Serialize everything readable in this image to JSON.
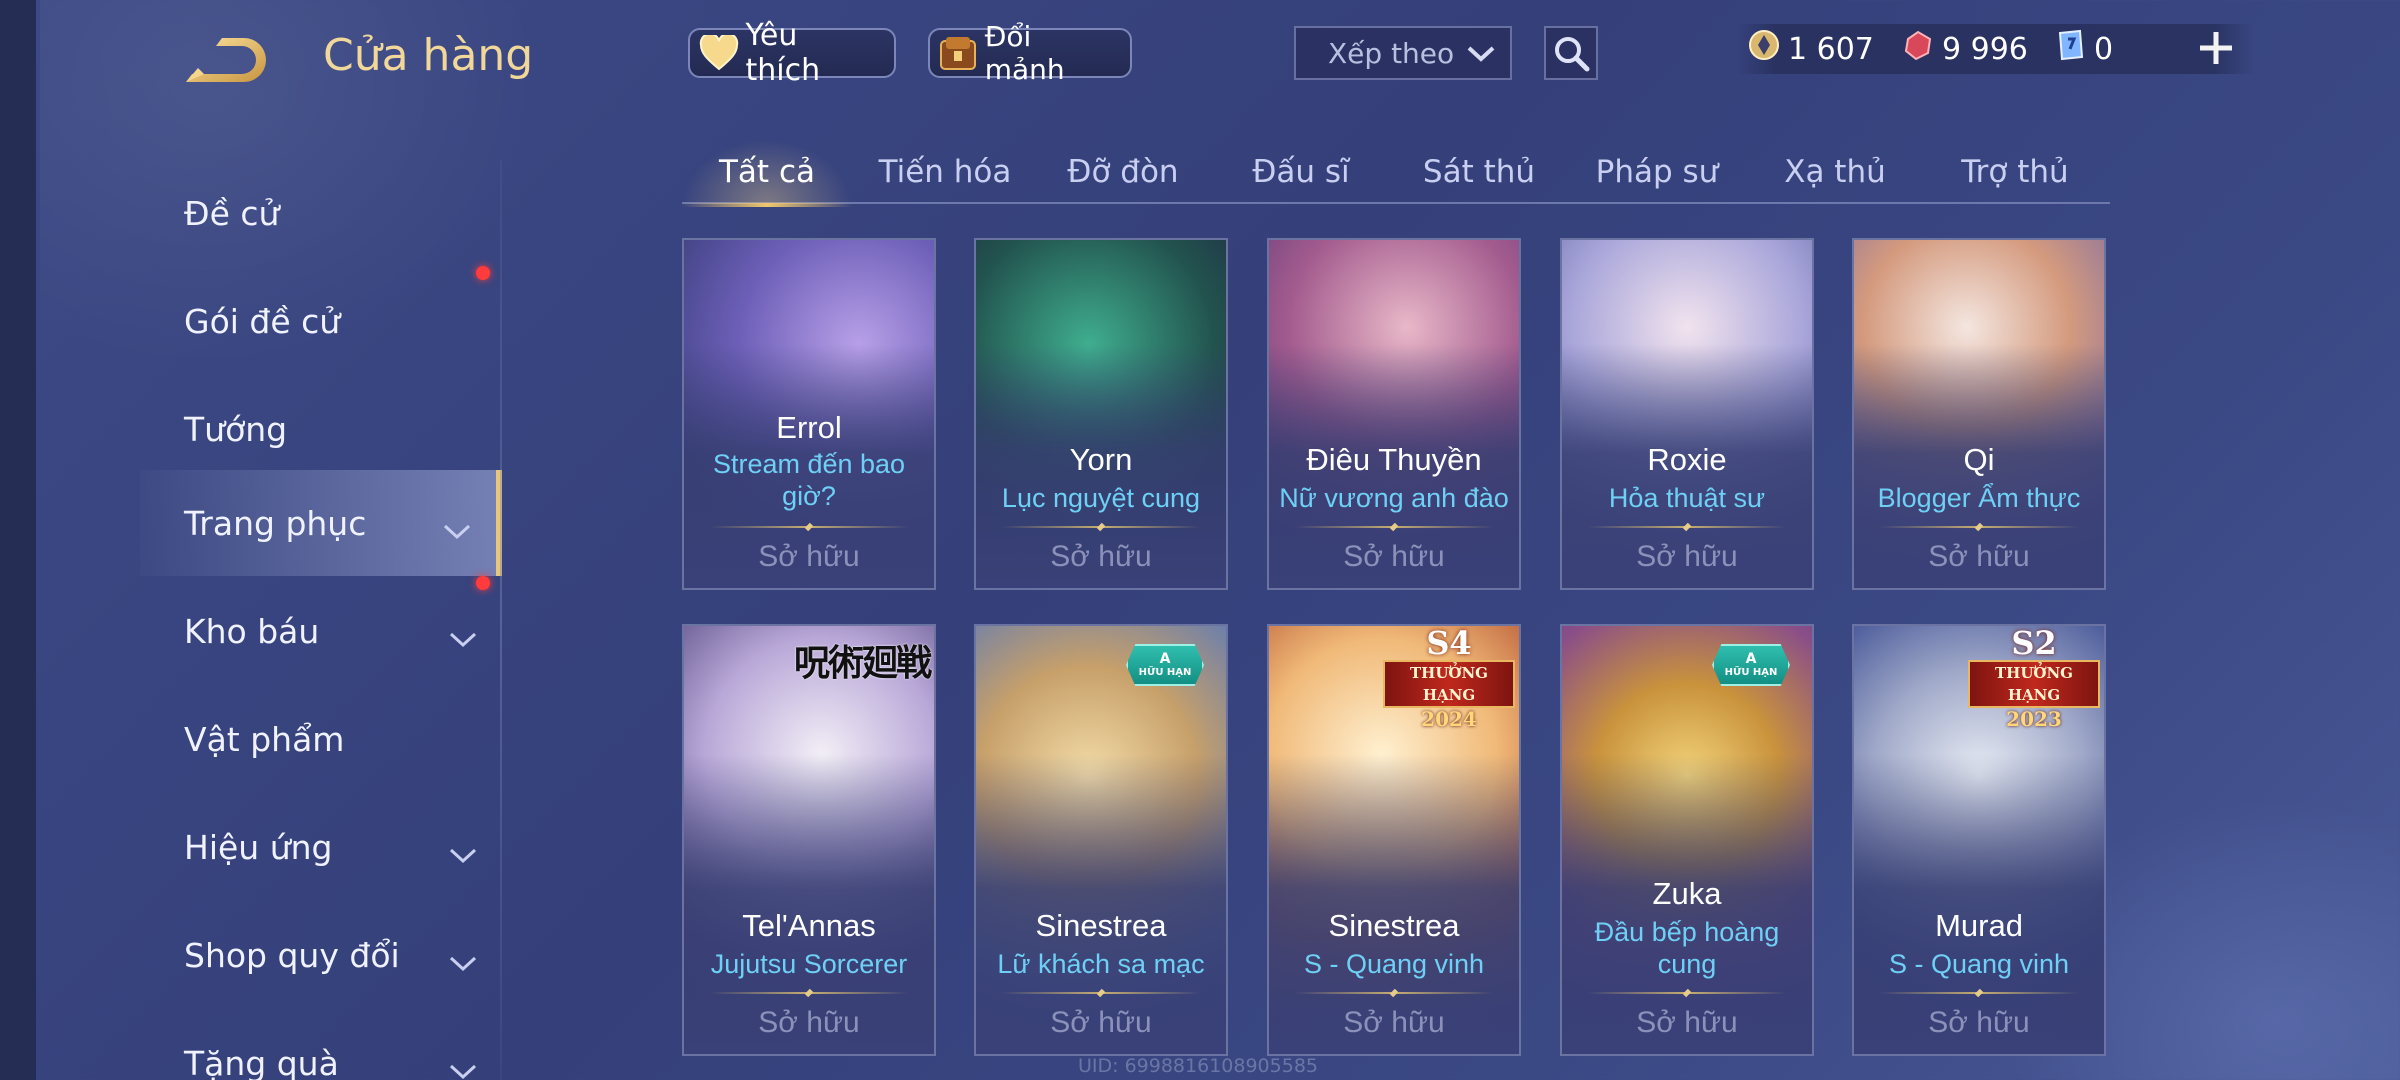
{
  "header": {
    "title": "Cửa hàng",
    "favorites_label": "Yêu thích",
    "shard_label": "Đổi mảnh",
    "sort_placeholder": "Xếp theo"
  },
  "currency": {
    "coins": "1 607",
    "vouchers": "9 996",
    "tickets": "0"
  },
  "sidebar": {
    "items": [
      {
        "label": "Đề cử"
      },
      {
        "label": "Gói đề cử"
      },
      {
        "label": "Tướng"
      },
      {
        "label": "Trang phục"
      },
      {
        "label": "Kho báu"
      },
      {
        "label": "Vật phẩm"
      },
      {
        "label": "Hiệu ứng"
      },
      {
        "label": "Shop quy đổi"
      },
      {
        "label": "Tặng quà"
      }
    ]
  },
  "tabs": [
    "Tất cả",
    "Tiến hóa",
    "Đỡ đòn",
    "Đấu sĩ",
    "Sát thủ",
    "Pháp sư",
    "Xạ thủ",
    "Trợ thủ"
  ],
  "cards": [
    {
      "hero": "Errol",
      "skin": "Stream đến bao giờ?",
      "status": "Sở hữu"
    },
    {
      "hero": "Yorn",
      "skin": "Lục nguyệt cung",
      "status": "Sở hữu"
    },
    {
      "hero": "Điêu Thuyền",
      "skin": "Nữ vương anh đào",
      "status": "Sở hữu"
    },
    {
      "hero": "Roxie",
      "skin": "Hỏa thuật sư",
      "status": "Sở hữu"
    },
    {
      "hero": "Qi",
      "skin": "Blogger Ẩm thực",
      "status": "Sở hữu"
    },
    {
      "hero": "Tel'Annas",
      "skin": "Jujutsu Sorcerer",
      "status": "Sở hữu",
      "logo": "呪術廻戦"
    },
    {
      "hero": "Sinestrea",
      "skin": "Lữ khách sa mạc",
      "status": "Sở hữu",
      "badge": "A",
      "badge_sub": "HỮU HẠN"
    },
    {
      "hero": "Sinestrea",
      "skin": "S - Quang vinh",
      "status": "Sở hữu",
      "rank": "S4",
      "rank_band": "THƯỞNG HẠNG",
      "rank_year": "2024"
    },
    {
      "hero": "Zuka",
      "skin": "Đầu bếp hoàng cung",
      "status": "Sở hữu",
      "badge": "A",
      "badge_sub": "HỮU HẠN"
    },
    {
      "hero": "Murad",
      "skin": "S - Quang vinh",
      "status": "Sở hữu",
      "rank": "S2",
      "rank_band": "THƯỞNG HẠNG",
      "rank_year": "2023"
    }
  ],
  "footer": {
    "uid": "UID: 6998816108905585"
  }
}
